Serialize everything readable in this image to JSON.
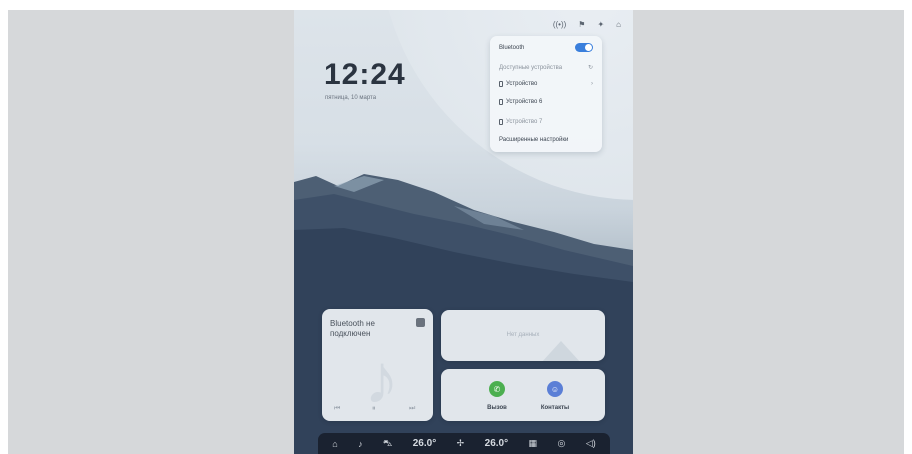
{
  "clock": {
    "time": "12:24",
    "date": "пятница, 10 марта"
  },
  "status_bar": {
    "icons": [
      "wifi-icon",
      "flag-icon",
      "settings-icon",
      "profile-icon"
    ]
  },
  "bluetooth_panel": {
    "title": "Bluetooth",
    "enabled": true,
    "subtitle": "Доступные устройства",
    "devices": [
      {
        "name": "Устройство",
        "dim": false
      },
      {
        "name": "Устройство 6",
        "dim": false
      },
      {
        "name": "Устройство 7",
        "dim": true
      }
    ],
    "advanced_link": "Расширенные настройки"
  },
  "media_card": {
    "title": "Bluetooth не подключен",
    "controls": [
      "⏮",
      "⏸",
      "⏭"
    ]
  },
  "nodata_card": {
    "text": "Нет данных"
  },
  "call_card": {
    "items": [
      {
        "label": "Вызов",
        "color": "#4caf50"
      },
      {
        "label": "Контакты",
        "color": "#5b7fd6"
      }
    ]
  },
  "dock": {
    "icons": [
      "home-icon",
      "music-icon",
      "car-icon",
      "fan-icon",
      "grid-icon",
      "steering-icon",
      "volume-icon"
    ],
    "temp_left": "26.0°",
    "temp_right": "26.0°"
  }
}
